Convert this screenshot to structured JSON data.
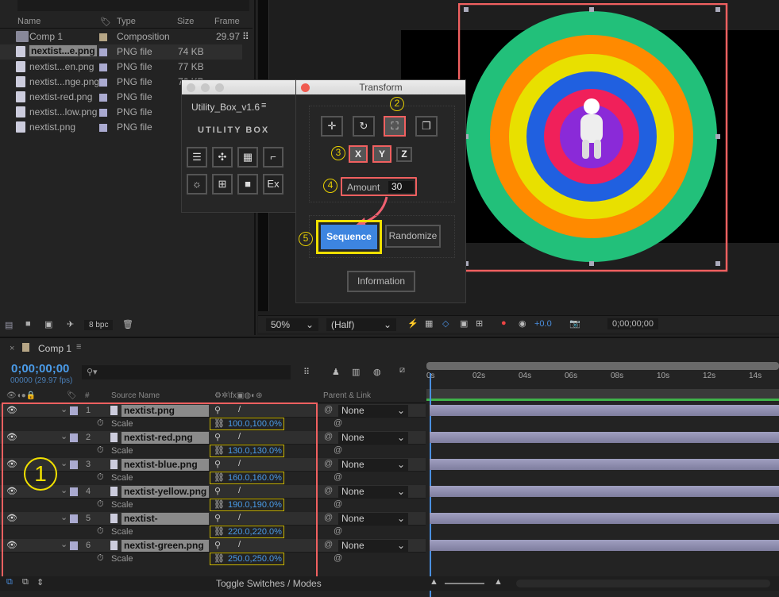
{
  "project": {
    "columns": {
      "name": "Name",
      "type": "Type",
      "size": "Size",
      "frame": "Frame"
    },
    "items": [
      {
        "name": "Comp 1",
        "type": "Composition",
        "size": "",
        "frame": "29.97",
        "kind": "comp",
        "label": "#b5a585"
      },
      {
        "name": "nextist...e.png",
        "type": "PNG file",
        "size": "74 KB",
        "kind": "png",
        "label": "#aaaad0",
        "selected": true
      },
      {
        "name": "nextist...en.png",
        "type": "PNG file",
        "size": "77 KB",
        "kind": "png",
        "label": "#aaaad0"
      },
      {
        "name": "nextist...nge.png",
        "type": "PNG file",
        "size": "76 KB",
        "kind": "png",
        "label": "#aaaad0"
      },
      {
        "name": "nextist-red.png",
        "type": "PNG file",
        "size": "",
        "kind": "png",
        "label": "#aaaad0"
      },
      {
        "name": "nextist...low.png",
        "type": "PNG file",
        "size": "",
        "kind": "png",
        "label": "#aaaad0"
      },
      {
        "name": "nextist.png",
        "type": "PNG file",
        "size": "",
        "kind": "png",
        "label": "#aaaad0"
      }
    ],
    "bpc": "8 bpc"
  },
  "utility": {
    "title": "Utility_Box_v1.6",
    "logo": "UTILITY BOX",
    "buttons": [
      "align",
      "anchor",
      "grid",
      "path",
      "sun",
      "distribute",
      "camera",
      "Ex"
    ]
  },
  "transform": {
    "title": "Transform",
    "modes": [
      "position",
      "rotation",
      "scale",
      "opacity"
    ],
    "selected_mode": "scale",
    "axes": [
      "X",
      "Y",
      "Z"
    ],
    "selected_axes": [
      "X",
      "Y"
    ],
    "amount_label": "Amount",
    "amount_value": "30",
    "sequence": "Sequence",
    "randomize": "Randomize",
    "information": "Information",
    "steps": [
      "1",
      "2",
      "3",
      "4",
      "5"
    ]
  },
  "viewer": {
    "zoom": "50%",
    "resolution": "(Half)",
    "exposure": "+0.0",
    "timecode": "0;00;00;00"
  },
  "timeline": {
    "tab": "Comp 1",
    "timecode": "0;00;00;00",
    "fps": "00000 (29.97 fps)",
    "headers": {
      "num": "#",
      "source": "Source Name",
      "parent": "Parent & Link"
    },
    "ticks": [
      "0s",
      "02s",
      "04s",
      "06s",
      "08s",
      "10s",
      "12s",
      "14s"
    ],
    "layers": [
      {
        "num": "1",
        "name": "nextist.png",
        "prop": "Scale",
        "value": "100.0,100.0%",
        "parent": "None"
      },
      {
        "num": "2",
        "name": "nextist-red.png",
        "prop": "Scale",
        "value": "130.0,130.0%",
        "parent": "None"
      },
      {
        "num": "3",
        "name": "nextist-blue.png",
        "prop": "Scale",
        "value": "160.0,160.0%",
        "parent": "None"
      },
      {
        "num": "4",
        "name": "nextist-yellow.png",
        "prop": "Scale",
        "value": "190.0,190.0%",
        "parent": "None"
      },
      {
        "num": "5",
        "name": "nextist-orange.png",
        "prop": "Scale",
        "value": "220.0,220.0%",
        "parent": "None"
      },
      {
        "num": "6",
        "name": "nextist-green.png",
        "prop": "Scale",
        "value": "250.0,250.0%",
        "parent": "None"
      }
    ],
    "toggle": "Toggle Switches / Modes"
  },
  "colors": {
    "accent": "#4a8fe0",
    "highlight_red": "#f06060",
    "highlight_yellow": "#e8d000",
    "rings": [
      "#22c07a",
      "#ff8a00",
      "#e8e000",
      "#2060e0",
      "#f0205a",
      "#8a2ad8"
    ]
  }
}
